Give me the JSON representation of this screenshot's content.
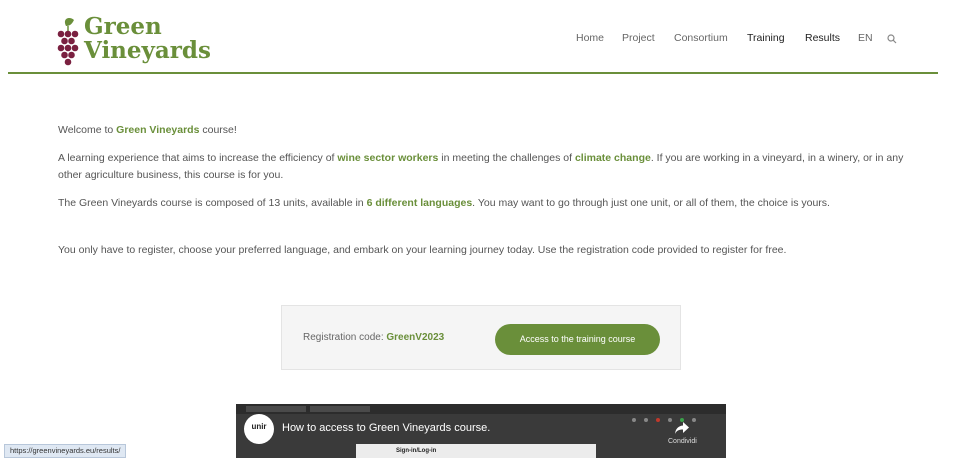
{
  "logo": {
    "line1": "Green",
    "line2": "Vineyards"
  },
  "nav": {
    "items": [
      {
        "label": "Home"
      },
      {
        "label": "Project"
      },
      {
        "label": "Consortium"
      },
      {
        "label": "Training"
      },
      {
        "label": "Results"
      },
      {
        "label": "EN"
      }
    ],
    "search_icon": "search-icon"
  },
  "content": {
    "welcome_prefix": "Welcome to ",
    "welcome_highlight": "Green Vineyards",
    "welcome_suffix": " course!",
    "p2_a": "A learning experience that aims to increase the efficiency of ",
    "p2_hl1": "wine sector workers",
    "p2_b": " in meeting the challenges of ",
    "p2_hl2": "climate change",
    "p2_c": ". If you are working in a vineyard,  in a winery, or  in any other agriculture business, this course is for you.",
    "p3_a": "The Green Vineyards course is composed of 13 units, available in ",
    "p3_hl": "6 different languages",
    "p3_b": ". You may want to go through just one unit, or all of them, the choice is yours.",
    "p4": "You only have to register, choose your preferred language, and embark on your learning journey today. Use the registration code provided to register for free."
  },
  "registration": {
    "label": "Registration code: ",
    "code": "GreenV2023",
    "button": "Access to the training course"
  },
  "video": {
    "channel": "unir",
    "title": "How to access to Green Vineyards course.",
    "share_label": "Condividi",
    "inner_text": "Sign-in/Log-in"
  },
  "status_bar": {
    "url": "https://greenvineyards.eu/results/"
  },
  "colors": {
    "brand_green": "#6a8f3a",
    "grape_purple": "#7a2040"
  }
}
